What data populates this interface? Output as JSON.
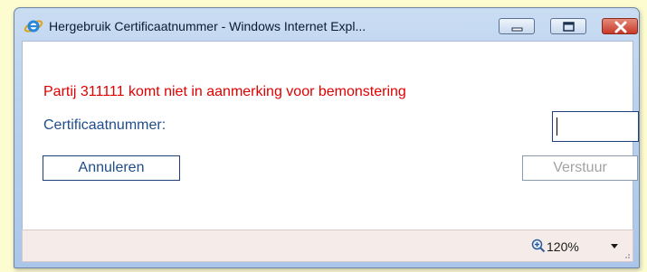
{
  "window": {
    "title": "Hergebruik Certificaatnummer - Windows Internet Expl...",
    "controls": [
      "minimize-icon",
      "maximize-icon",
      "close-icon"
    ],
    "app_icon": "internet-explorer-icon"
  },
  "dialog": {
    "message": "Partij 311111 komt niet in aanmerking voor bemonstering",
    "certificate_label": "Certificaatnummer:",
    "certificate_value": "",
    "cancel_label": "Annuleren",
    "submit_label": "Verstuur"
  },
  "statusbar": {
    "zoom": "120%",
    "zoom_icon": "zoom-magnifier-icon",
    "dropdown_icon": "chevron-down-icon"
  },
  "colors": {
    "message": "#e00000",
    "label": "#1e4d8c",
    "disabled_text": "#a3a3a3",
    "page_background": "#fdfbd0"
  }
}
